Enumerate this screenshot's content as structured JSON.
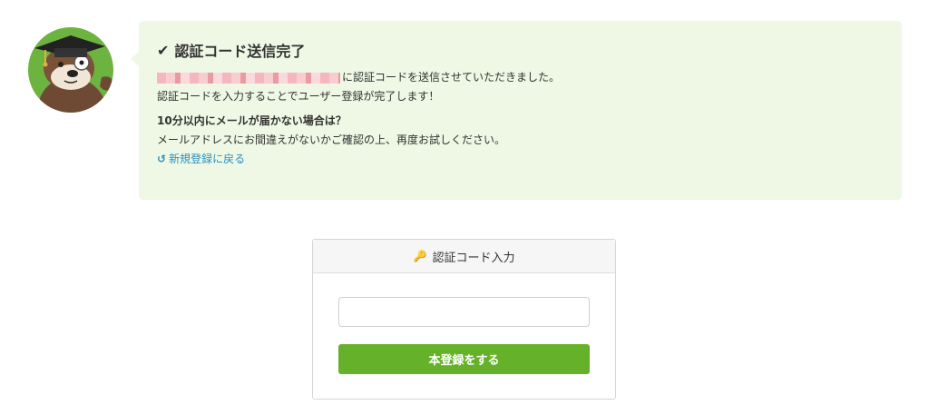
{
  "message": {
    "title": "認証コード送信完了",
    "title_icon": "check-icon",
    "sent_suffix": "に認証コードを送信させていただきました。",
    "instruction": "認証コードを入力することでユーザー登録が完了します！",
    "help_heading": "10分以内にメールが届かない場合は？",
    "help_text": "メールアドレスにお間違えがないかご確認の上、再度お試しください。",
    "back_link": "新規登録に戻る",
    "back_icon": "undo-icon"
  },
  "form": {
    "header_label": "認証コード入力",
    "header_icon": "key-icon",
    "code_value": "",
    "submit_label": "本登録をする"
  },
  "colors": {
    "bubble_bg": "#eef8e4",
    "accent_green": "#66b12a",
    "link_blue": "#2b8fc4"
  }
}
